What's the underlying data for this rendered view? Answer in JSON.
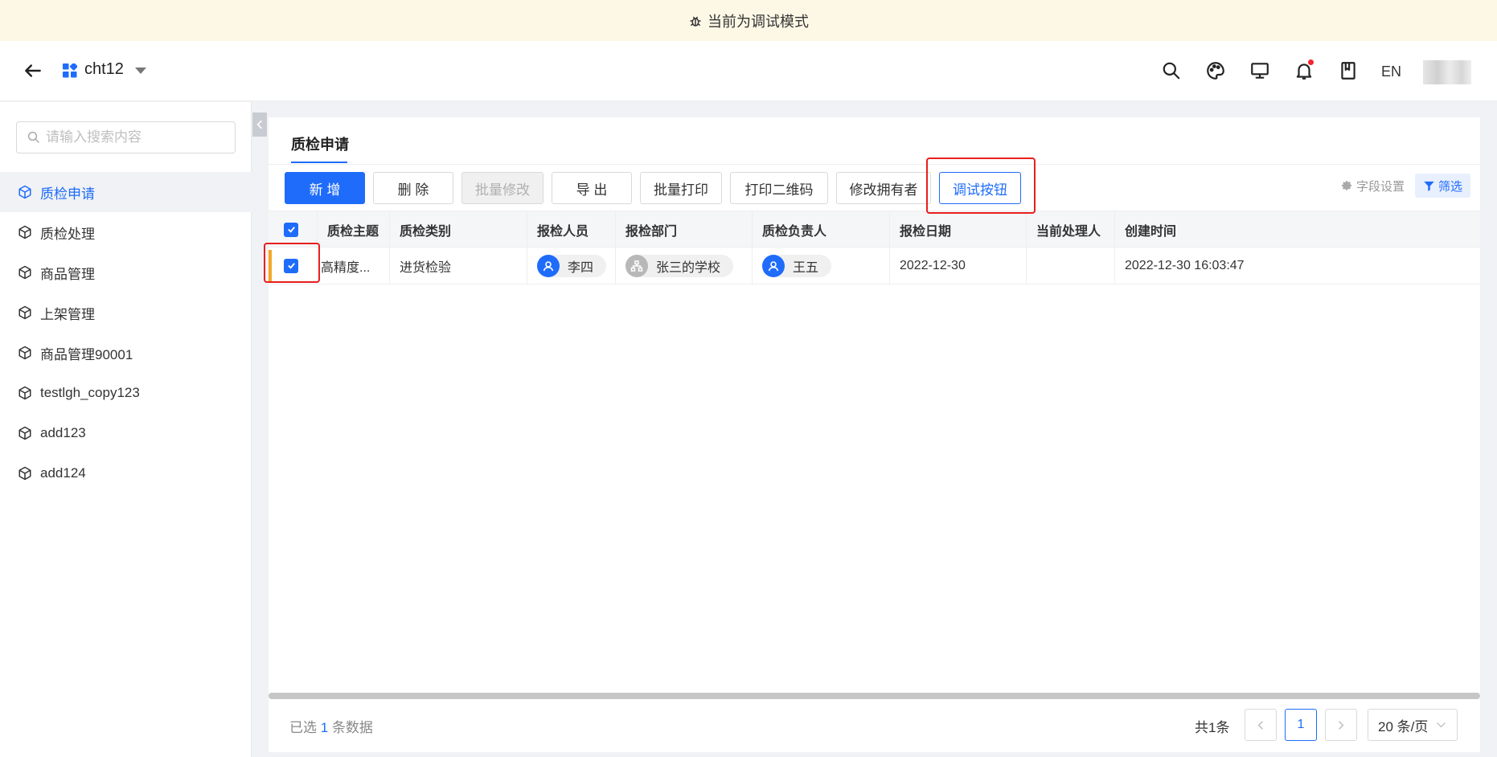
{
  "banner": {
    "icon": "bug-icon",
    "text": "当前为调试模式"
  },
  "topbar": {
    "app_name": "cht12",
    "icons": [
      "search-icon",
      "palette-icon",
      "monitor-icon",
      "bell-icon",
      "bookmark-icon"
    ],
    "lang": "EN"
  },
  "sidebar": {
    "search_placeholder": "请输入搜索内容",
    "items": [
      {
        "label": "质检申请",
        "icon": "cube-icon",
        "active": true
      },
      {
        "label": "质检处理",
        "icon": "cube-icon"
      },
      {
        "label": "商品管理",
        "icon": "cube-icon"
      },
      {
        "label": "上架管理",
        "icon": "cube-icon"
      },
      {
        "label": "商品管理90001",
        "icon": "cube-icon"
      },
      {
        "label": "testlgh_copy123",
        "icon": "cube-icon"
      },
      {
        "label": "add123",
        "icon": "cube-icon"
      },
      {
        "label": "add124",
        "icon": "cube-icon"
      }
    ]
  },
  "main": {
    "tab": "质检申请",
    "toolbar": {
      "add": "新 增",
      "delete": "删 除",
      "batch_edit": "批量修改",
      "export": "导 出",
      "batch_print": "批量打印",
      "print_qr": "打印二维码",
      "change_owner": "修改拥有者",
      "debug": "调试按钮",
      "field_settings": "字段设置",
      "filter": "筛选"
    },
    "table": {
      "columns": [
        "质检主题",
        "质检类别",
        "报检人员",
        "报检部门",
        "质检负责人",
        "报检日期",
        "当前处理人",
        "创建时间"
      ],
      "rows": [
        {
          "subject": "高精度...",
          "category": "进货检验",
          "inspector": "李四",
          "department": "张三的学校",
          "owner": "王五",
          "date": "2022-12-30",
          "handler": "",
          "created": "2022-12-30 16:03:47"
        }
      ]
    },
    "footer": {
      "selected_prefix": "已选",
      "selected_count": "1",
      "selected_suffix": "条数据",
      "total": "共1条",
      "current_page": "1",
      "page_size": "20 条/页"
    }
  },
  "colors": {
    "primary": "#1f6cfa",
    "highlight_box": "#e81e1e",
    "row_marker": "#f5a623",
    "banner_bg": "#fdf8e6"
  }
}
